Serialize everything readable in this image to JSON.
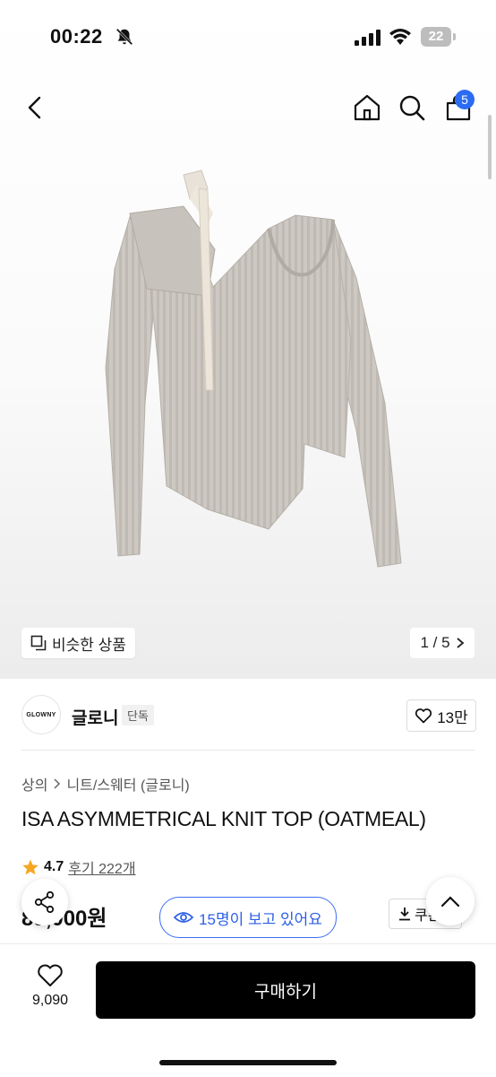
{
  "status_bar": {
    "time": "00:22",
    "battery": "22"
  },
  "header": {
    "cart_count": "5",
    "icons": [
      "back-icon",
      "home-icon",
      "search-icon",
      "cart-icon"
    ]
  },
  "gallery": {
    "similar_label": "비슷한 상품",
    "pager": "1 / 5"
  },
  "brand": {
    "logo_text": "GLOWNY",
    "name": "글로니",
    "tag": "단독",
    "likes": "13만"
  },
  "breadcrumb": [
    "상의",
    "니트/스웨터 (글로니)"
  ],
  "product": {
    "title": "ISA ASYMMETRICAL KNIT TOP (OATMEAL)",
    "rating": "4.7",
    "reviews": "후기 222개",
    "price": "89,000원",
    "viewers": "15명이 보고 있어요",
    "coupon": "쿠폰"
  },
  "bottom_bar": {
    "wish_count": "9,090",
    "buy_label": "구매하기"
  },
  "colors": {
    "accent_blue": "#2d5fe6",
    "star": "#f5a623",
    "buy_button": "#000000"
  }
}
